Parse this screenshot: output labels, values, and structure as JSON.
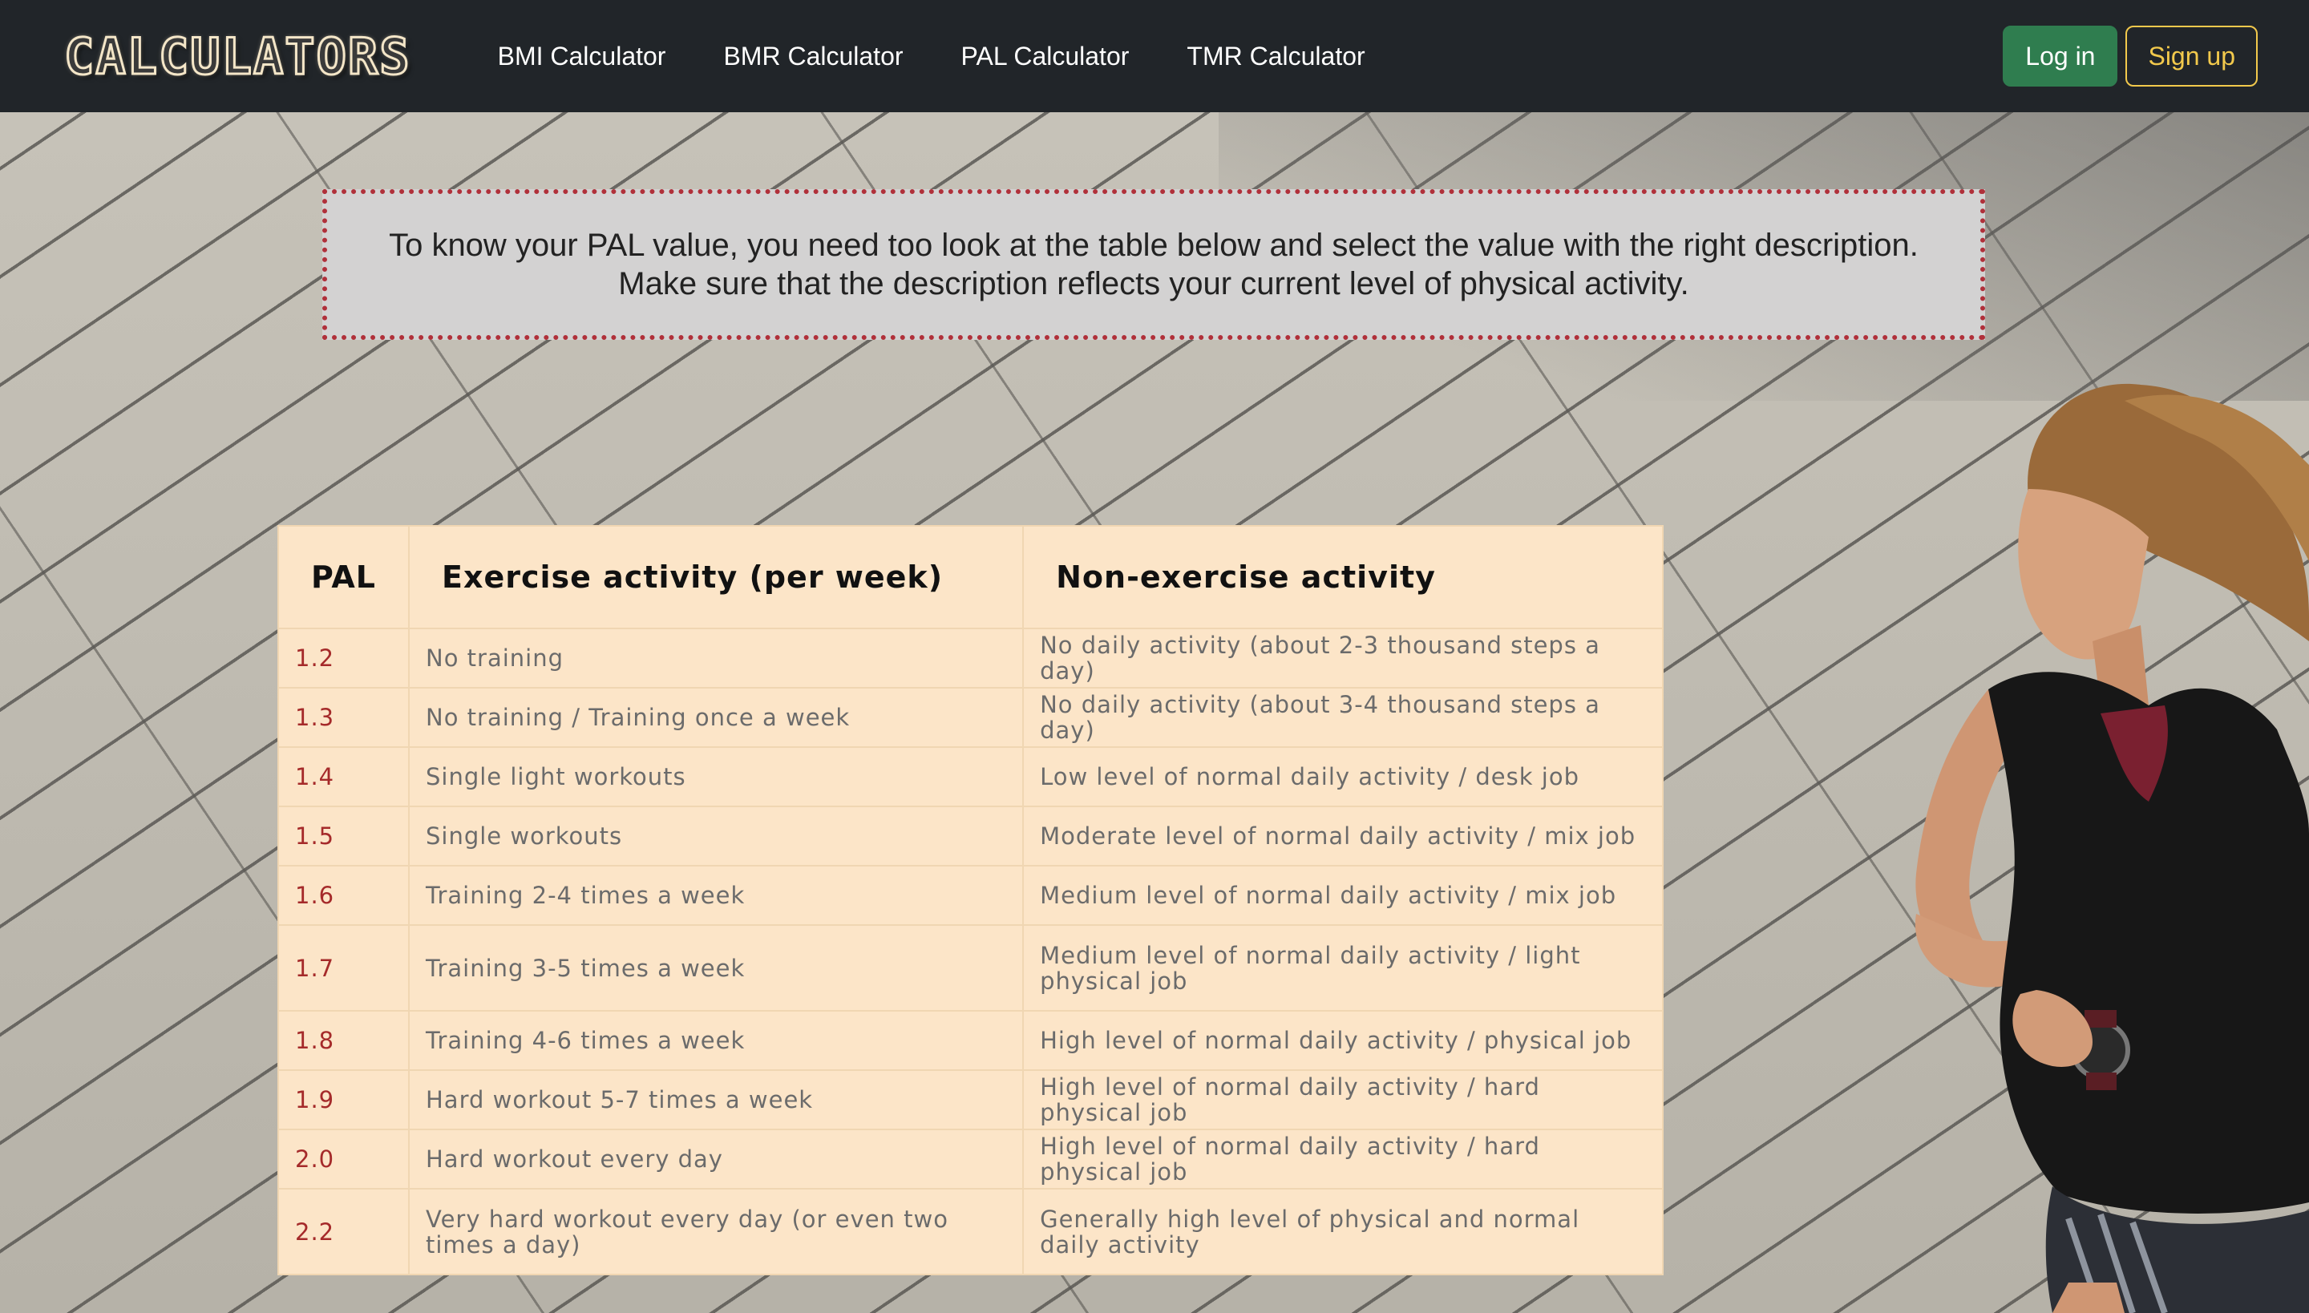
{
  "navbar": {
    "brand": "CALCULATORS",
    "links": [
      "BMI Calculator",
      "BMR Calculator",
      "PAL Calculator",
      "TMR Calculator"
    ],
    "login_label": "Log in",
    "signup_label": "Sign up"
  },
  "info": {
    "line1": "To know your PAL value, you need too look at the table below and select the value with the right description.",
    "line2": "Make sure that the description reflects your current level of physical activity."
  },
  "table": {
    "headers": [
      "PAL",
      "Exercise activity (per week)",
      "Non-exercise activity"
    ],
    "rows": [
      {
        "pal": "1.2",
        "exercise": "No training",
        "non_exercise": "No daily activity (about 2-3 thousand steps a day)"
      },
      {
        "pal": "1.3",
        "exercise": "No training / Training once a week",
        "non_exercise": "No daily activity (about 3-4 thousand steps a day)"
      },
      {
        "pal": "1.4",
        "exercise": "Single light workouts",
        "non_exercise": "Low level of normal daily activity / desk job"
      },
      {
        "pal": "1.5",
        "exercise": "Single workouts",
        "non_exercise": "Moderate level of normal daily activity / mix job"
      },
      {
        "pal": "1.6",
        "exercise": "Training 2-4 times a week",
        "non_exercise": "Medium level of normal daily activity / mix job"
      },
      {
        "pal": "1.7",
        "exercise": "Training 3-5 times a week",
        "non_exercise": "Medium level of normal daily activity / light physical job"
      },
      {
        "pal": "1.8",
        "exercise": "Training 4-6 times a week",
        "non_exercise": "High level of normal daily activity / physical job"
      },
      {
        "pal": "1.9",
        "exercise": "Hard workout 5-7 times a week",
        "non_exercise": "High level of normal daily activity / hard physical job"
      },
      {
        "pal": "2.0",
        "exercise": "Hard workout every day",
        "non_exercise": "High level of normal daily activity / hard physical job"
      },
      {
        "pal": "2.2",
        "exercise": "Very hard workout every day (or even two times a day)",
        "non_exercise": "Generally high level of physical and normal daily activity"
      }
    ]
  },
  "colors": {
    "navbar_bg": "#212529",
    "login_bg": "#2f7d4f",
    "signup_accent": "#f2c94c",
    "table_bg": "#fce5c8",
    "pal_value": "#a52a2a",
    "info_border": "#b0303a"
  }
}
